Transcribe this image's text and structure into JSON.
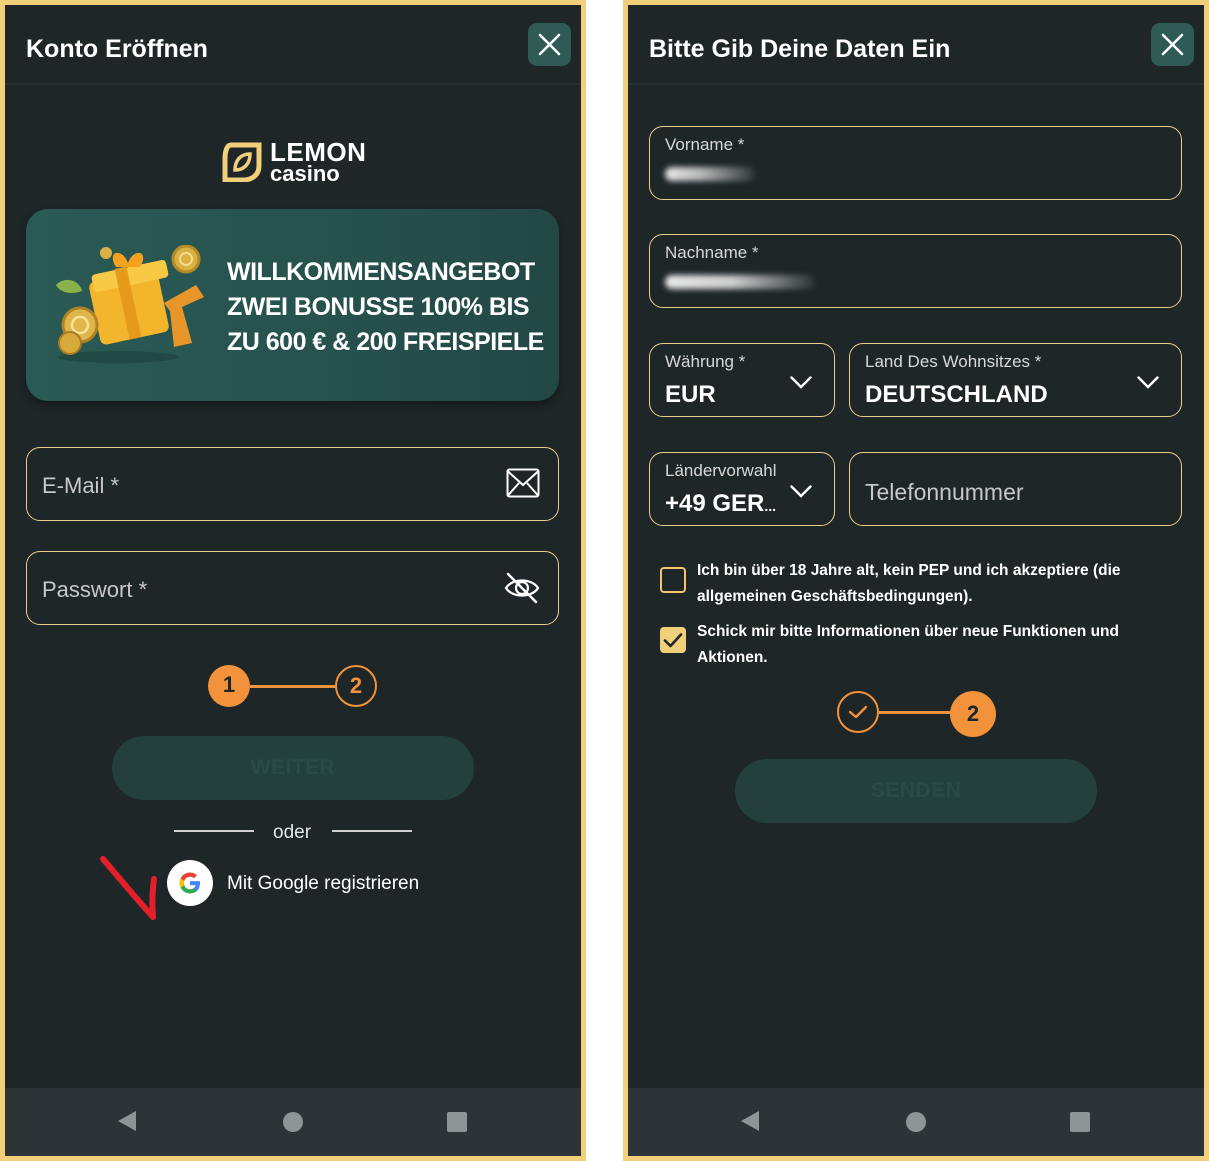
{
  "left": {
    "title": "Konto Eröffnen",
    "logo": {
      "top": "LEMON",
      "bottom": "casino"
    },
    "banner": {
      "line1": "WILLKOMMENSANGEBOT",
      "line2": "ZWEI BONUSSE 100% BIS",
      "line3": "ZU 600 € & 200 FREISPIELE"
    },
    "email_placeholder": "E-Mail *",
    "password_placeholder": "Passwort *",
    "stepper": {
      "step1": "1",
      "step2": "2",
      "current": 1
    },
    "next_button": "WEITER",
    "divider_text": "oder",
    "google_button": "Mit Google registrieren"
  },
  "right": {
    "title": "Bitte Gib Deine Daten Ein",
    "first_name_label": "Vorname *",
    "last_name_label": "Nachname *",
    "currency": {
      "label": "Währung *",
      "value": "EUR"
    },
    "country": {
      "label": "Land Des Wohnsitzes *",
      "value": "DEUTSCHLAND"
    },
    "dial_code": {
      "label": "Ländervorwahl",
      "value": "+49 GER",
      "ellipsis": "..."
    },
    "phone_placeholder": "Telefonnummer",
    "terms_checkbox": {
      "checked": false,
      "text": "Ich bin über 18 Jahre alt, kein PEP und ich akzeptiere (die allgemeinen Geschäftsbedingungen)."
    },
    "newsletter_checkbox": {
      "checked": true,
      "text": "Schick mir bitte Informationen über neue Funktionen und Aktionen."
    },
    "stepper": {
      "step2": "2",
      "current": 2
    },
    "submit_button": "SENDEN"
  },
  "colors": {
    "background": "#1e2628",
    "frame": "#f2cf7a",
    "accent": "#f2923a",
    "input_border": "#e9cf8d",
    "button_disabled": "#23403d"
  },
  "icons": [
    "close-icon",
    "mail-icon",
    "eye-off-icon",
    "chevron-down-icon",
    "check-icon",
    "google-icon",
    "back-icon",
    "home-icon",
    "recents-icon"
  ]
}
